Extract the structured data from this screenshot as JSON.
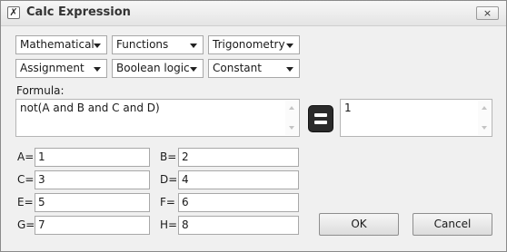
{
  "window": {
    "title": "Calc Expression",
    "close_glyph": "×",
    "app_icon_glyph": "✗"
  },
  "dropdowns": {
    "row1": [
      "Mathematical",
      "Functions",
      "Trigonometry"
    ],
    "row2": [
      "Assignment",
      "Boolean logic",
      "Constant"
    ]
  },
  "formula": {
    "label": "Formula:",
    "value": "not(A and B and C and D)"
  },
  "result": {
    "value": "1"
  },
  "variables": [
    {
      "label": "A=",
      "value": "1"
    },
    {
      "label": "B=",
      "value": "2"
    },
    {
      "label": "C=",
      "value": "3"
    },
    {
      "label": "D=",
      "value": "4"
    },
    {
      "label": "E=",
      "value": "5"
    },
    {
      "label": "F=",
      "value": "6"
    },
    {
      "label": "G=",
      "value": "7"
    },
    {
      "label": "H=",
      "value": "8"
    }
  ],
  "buttons": {
    "ok": "OK",
    "cancel": "Cancel"
  },
  "icons": {
    "app": "calculator-app-icon",
    "evaluate": "equals-icon",
    "close": "close-icon"
  }
}
